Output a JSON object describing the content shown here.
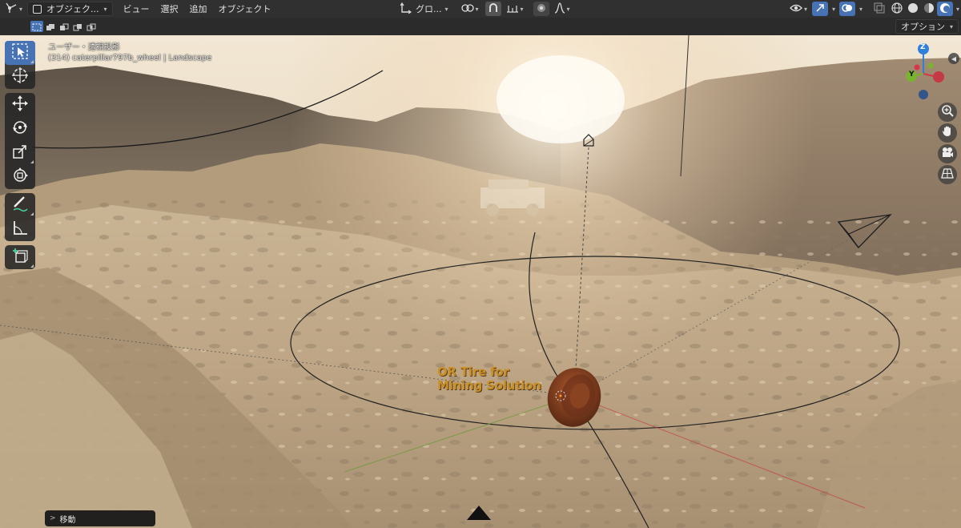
{
  "header": {
    "editor_type_icon": "3d-viewport-icon",
    "mode_label": "オブジェク...",
    "menus": [
      "ビュー",
      "選択",
      "追加",
      "オブジェクト"
    ],
    "transform_orientation": "グロ...",
    "pivot_icon": "pivot-icon",
    "snap_icon": "snap-magnet-icon",
    "proportional_icon": "proportional-edit-icon"
  },
  "tool_settings": {
    "options_label": "オプション"
  },
  "viewport": {
    "view_name": "ユーザー・透視投影",
    "object_info": "(314) caterpillar797b_wheel | Landscape",
    "text_object_line1": "OR Tire for",
    "text_object_line2": "Mining Solution",
    "gizmo_axes": {
      "z": "Z",
      "y": "Y"
    },
    "axis_colors": {
      "x": "#d9364a",
      "y": "#7ab32e",
      "z": "#2f7fdb"
    }
  },
  "operator_panel": {
    "label": "移動"
  },
  "colors": {
    "accent": "#4772b3",
    "header_bg": "#303030",
    "sky_glow": "#fff6e4",
    "terrain": "#b8a282"
  }
}
